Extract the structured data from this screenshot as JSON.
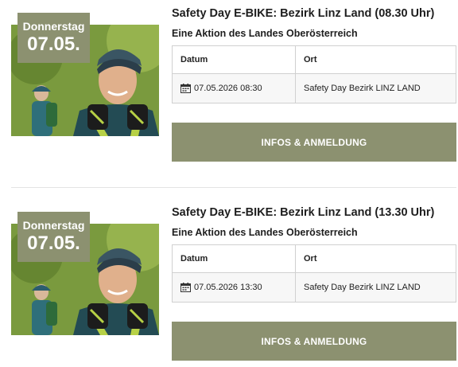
{
  "events": [
    {
      "date_badge": {
        "weekday": "Donnerstag",
        "day": "07.05."
      },
      "image_subject": "cyclist-with-helmet",
      "title": "Safety Day E-BIKE: Bezirk Linz Land (08.30 Uhr)",
      "subtitle": "Eine Aktion des Landes Oberösterreich",
      "table": {
        "headers": [
          "Datum",
          "Ort"
        ],
        "row": {
          "datetime": "07.05.2026 08:30",
          "location": "Safety Day Bezirk LINZ LAND"
        }
      },
      "button_label": "INFOS & ANMELDUNG"
    },
    {
      "date_badge": {
        "weekday": "Donnerstag",
        "day": "07.05."
      },
      "image_subject": "cyclist-with-helmet",
      "title": "Safety Day E-BIKE: Bezirk Linz Land (13.30 Uhr)",
      "subtitle": "Eine Aktion des Landes Oberösterreich",
      "table": {
        "headers": [
          "Datum",
          "Ort"
        ],
        "row": {
          "datetime": "07.05.2026 13:30",
          "location": "Safety Day Bezirk LINZ LAND"
        }
      },
      "button_label": "INFOS & ANMELDUNG"
    }
  ],
  "colors": {
    "accent": "#8c9170",
    "border": "#d0d0d0",
    "row_bg": "#f7f7f7"
  },
  "icons": {
    "date": "calendar-icon"
  }
}
